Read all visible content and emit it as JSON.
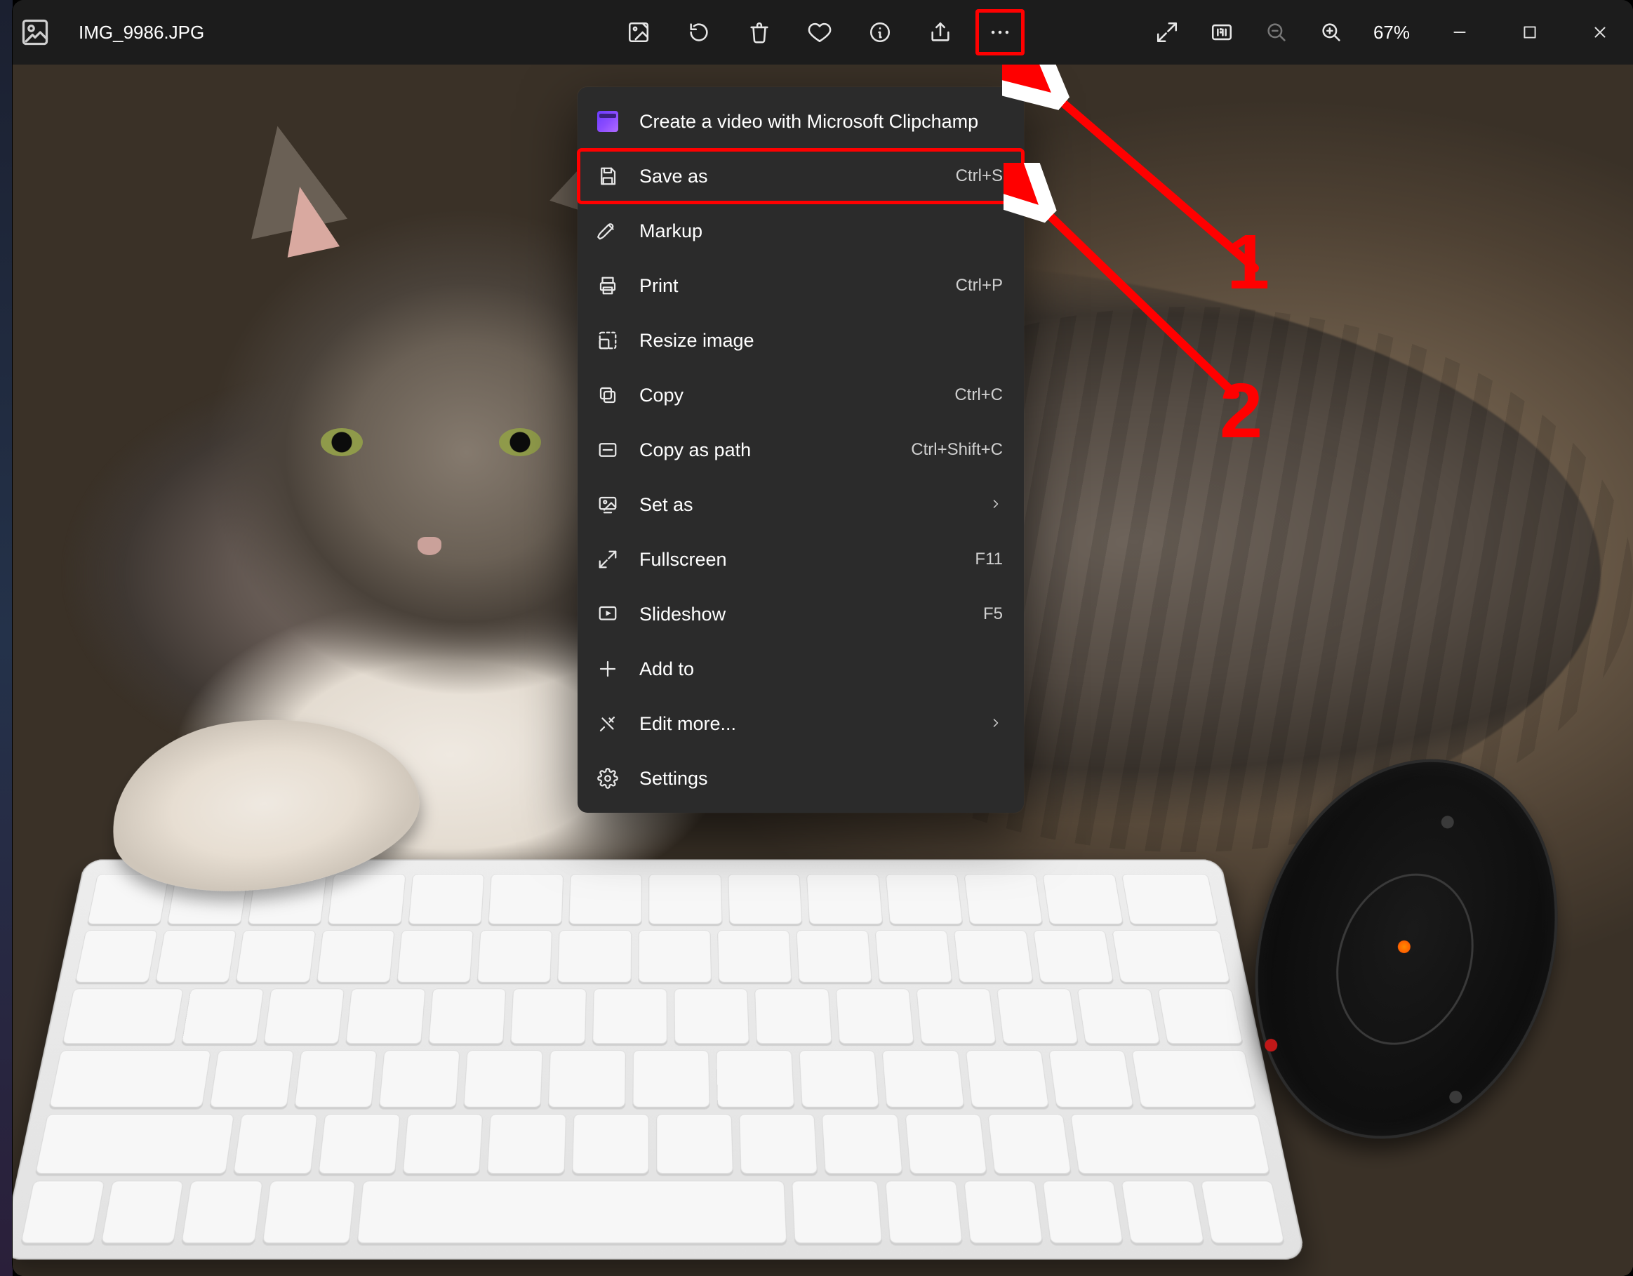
{
  "titlebar": {
    "filename": "IMG_9986.JPG",
    "zoom_label": "67%"
  },
  "menu": {
    "items": [
      {
        "label": "Create a video with Microsoft Clipchamp",
        "accel": "",
        "icon": "clipchamp",
        "chev": false
      },
      {
        "label": "Save as",
        "accel": "Ctrl+S",
        "icon": "save",
        "chev": false,
        "highlight": true
      },
      {
        "label": "Markup",
        "accel": "",
        "icon": "markup",
        "chev": false
      },
      {
        "label": "Print",
        "accel": "Ctrl+P",
        "icon": "print",
        "chev": false
      },
      {
        "label": "Resize image",
        "accel": "",
        "icon": "resize",
        "chev": false
      },
      {
        "label": "Copy",
        "accel": "Ctrl+C",
        "icon": "copy",
        "chev": false
      },
      {
        "label": "Copy as path",
        "accel": "Ctrl+Shift+C",
        "icon": "copypath",
        "chev": false
      },
      {
        "label": "Set as",
        "accel": "",
        "icon": "setas",
        "chev": true
      },
      {
        "label": "Fullscreen",
        "accel": "F11",
        "icon": "fullscreen",
        "chev": false
      },
      {
        "label": "Slideshow",
        "accel": "F5",
        "icon": "slideshow",
        "chev": false
      },
      {
        "label": "Add to",
        "accel": "",
        "icon": "plus",
        "chev": false
      },
      {
        "label": "Edit more...",
        "accel": "",
        "icon": "editmore",
        "chev": true
      },
      {
        "label": "Settings",
        "accel": "",
        "icon": "settings",
        "chev": false
      }
    ]
  },
  "annotations": {
    "num1": "1",
    "num2": "2"
  }
}
